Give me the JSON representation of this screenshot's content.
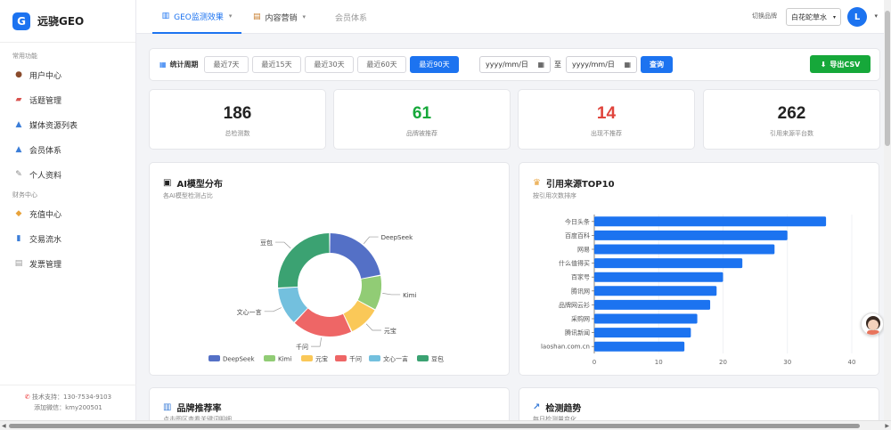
{
  "app": {
    "logo_letter": "G",
    "name": "远骁GEO"
  },
  "sidebar": {
    "sections": [
      {
        "title": "常用功能",
        "items": [
          {
            "label": "用户中心",
            "icon": "user-icon"
          },
          {
            "label": "话题管理",
            "icon": "topic-icon"
          },
          {
            "label": "媒体资源列表",
            "icon": "media-icon"
          },
          {
            "label": "会员体系",
            "icon": "member-icon"
          },
          {
            "label": "个人资料",
            "icon": "profile-icon"
          }
        ]
      },
      {
        "title": "财务中心",
        "items": [
          {
            "label": "充值中心",
            "icon": "recharge-icon"
          },
          {
            "label": "交易流水",
            "icon": "transactions-icon"
          },
          {
            "label": "发票管理",
            "icon": "invoice-icon"
          }
        ]
      }
    ],
    "footer": {
      "support": "技术支持：130-7534-9103",
      "wechat": "添加微信：kmy200501"
    }
  },
  "topbar": {
    "tabs": [
      {
        "label": "GEO监测效果",
        "icon": "chart-icon"
      },
      {
        "label": "内容营销",
        "icon": "document-icon"
      },
      {
        "label": "会员体系"
      }
    ],
    "brand_switch_label": "切换品牌",
    "brand_selected": "白花蛇草水",
    "avatar_letter": "L"
  },
  "filter": {
    "period_label": "统计周期",
    "periods": [
      "最近7天",
      "最近15天",
      "最近30天",
      "最近60天",
      "最近90天"
    ],
    "active_period": "最近90天",
    "date_placeholder": "yyyy/mm/日",
    "date_separator": "至",
    "query_label": "查询",
    "export_label": "导出CSV"
  },
  "stats": [
    {
      "value": "186",
      "label": "总检测数",
      "color": "#222222"
    },
    {
      "value": "61",
      "label": "品牌被推荐",
      "color": "#16a83a"
    },
    {
      "value": "14",
      "label": "出现不推荐",
      "color": "#e0443c"
    },
    {
      "value": "262",
      "label": "引用来源平台数",
      "color": "#222222"
    }
  ],
  "ai_chart": {
    "title": "AI模型分布",
    "subtitle": "各AI模型检测占比"
  },
  "source_chart": {
    "title": "引用来源TOP10",
    "subtitle": "按引用次数排序"
  },
  "lower_cards": [
    {
      "title": "品牌推荐率",
      "subtitle": "点击图区查看关键词明细",
      "icon": "bar-chart-icon"
    },
    {
      "title": "检测趋势",
      "subtitle": "每日检测量变化",
      "icon": "trend-icon"
    }
  ],
  "chart_data": [
    {
      "type": "pie",
      "donut": true,
      "categories": [
        "DeepSeek",
        "Kimi",
        "元宝",
        "千问",
        "文心一言",
        "豆包"
      ],
      "values": [
        22,
        11,
        10,
        19,
        12,
        26
      ],
      "colors": [
        "#5470c6",
        "#91cc75",
        "#fac858",
        "#ee6666",
        "#73c0de",
        "#3ba272"
      ],
      "legend": "bottom"
    },
    {
      "type": "bar",
      "orientation": "horizontal",
      "categories": [
        "今日头条",
        "百度百科",
        "网易",
        "什么值得买",
        "百家号",
        "腾讯网",
        "品牌网云衫",
        "采购网",
        "腾讯新闻",
        "laoshan.com.cn"
      ],
      "values": [
        36,
        30,
        28,
        23,
        20,
        19,
        18,
        16,
        15,
        14
      ],
      "xlim": [
        0,
        40
      ],
      "xticks": [
        0,
        10,
        20,
        30,
        40
      ],
      "color": "#1c73f0",
      "grid": true
    }
  ]
}
